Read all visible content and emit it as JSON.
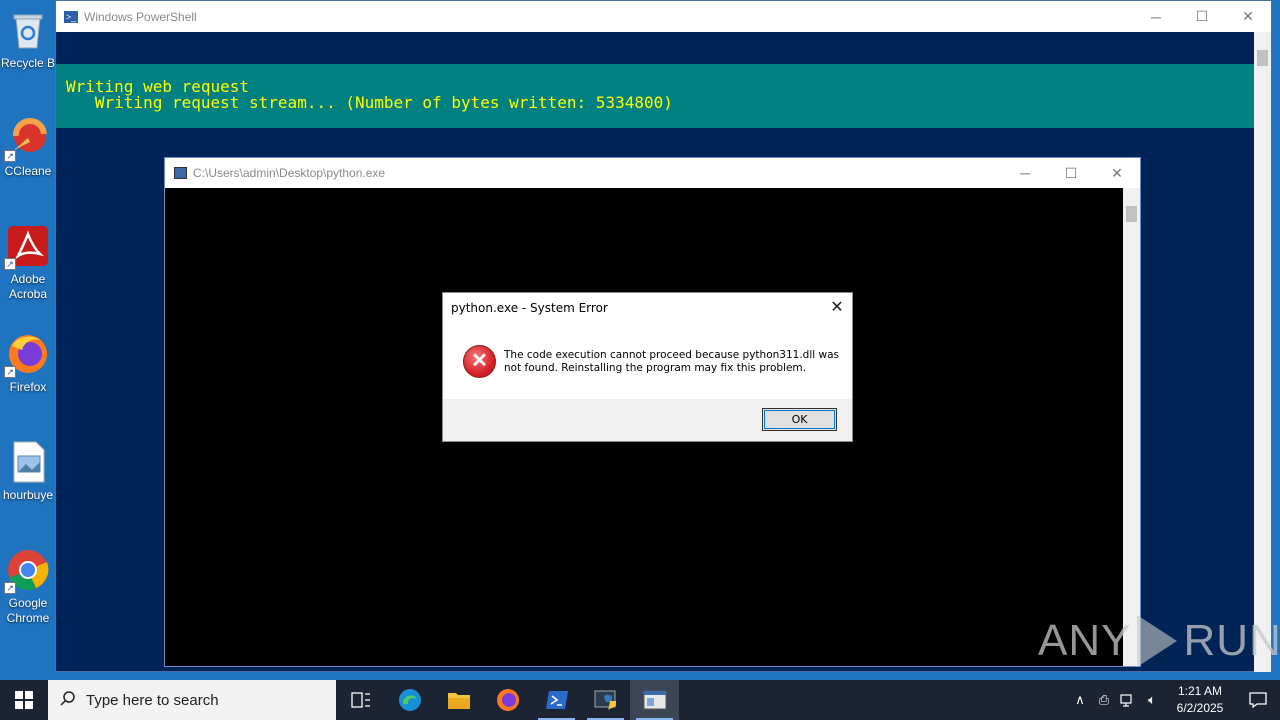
{
  "desktop": {
    "icons": [
      {
        "label": "Recycle B",
        "icon": "recycle-bin-icon"
      },
      {
        "label": "CCleane",
        "icon": "ccleaner-icon"
      },
      {
        "label": "Adobe Acroba",
        "icon": "adobe-acrobat-icon"
      },
      {
        "label": "Firefox",
        "icon": "firefox-icon"
      },
      {
        "label": "hourbuye",
        "icon": "image-file-icon"
      },
      {
        "label": "Google Chrome",
        "icon": "chrome-icon"
      }
    ]
  },
  "powershell": {
    "title": "Windows PowerShell",
    "progress_line1": "Writing web request",
    "progress_line2": "   Writing request stream... (Number of bytes written: 5334800)"
  },
  "python_window": {
    "title": "C:\\Users\\admin\\Desktop\\python.exe"
  },
  "dialog": {
    "title": "python.exe - System Error",
    "message": "The code execution cannot proceed because python311.dll was not found. Reinstalling the program may fix this problem.",
    "ok_label": "OK"
  },
  "watermark": {
    "left": "ANY",
    "right": "RUN"
  },
  "taskbar": {
    "search_placeholder": "Type here to search",
    "time": "1:21 AM",
    "date": "6/2/2025"
  },
  "colors": {
    "ps_background": "#012456",
    "progress_background": "#008080",
    "progress_text": "#ffff00",
    "taskbar": "#1c2434"
  }
}
